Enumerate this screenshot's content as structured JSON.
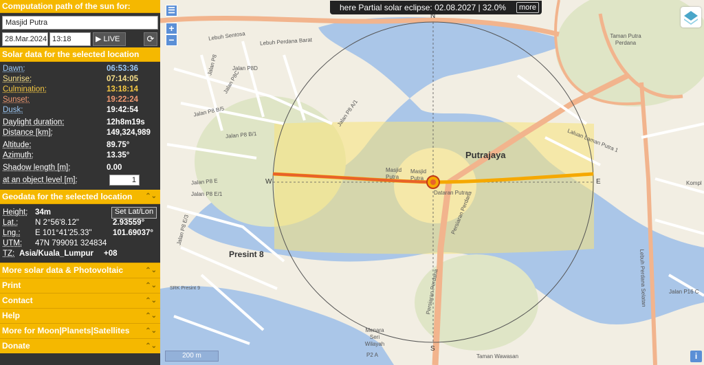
{
  "sidebar": {
    "title": "Computation path of the sun for:",
    "location": "Masjid Putra",
    "date": "28.Mar.2024",
    "time": "13:18 UTC+8",
    "live_label": "LIVE",
    "solar_header": "Solar data for the selected location",
    "solar": {
      "dawn_label": "Dawn:",
      "dawn": "06:53:36",
      "sunrise_label": "Sunrise:",
      "sunrise": "07:14:05",
      "culmination_label": "Culmination:",
      "culmination": "13:18:14",
      "sunset_label": "Sunset:",
      "sunset": "19:22:24",
      "dusk_label": "Dusk:",
      "dusk": "19:42:54",
      "daylight_label": "Daylight duration:",
      "daylight": "12h8m19s",
      "distance_label": "Distance [km]:",
      "distance": "149,324,989",
      "altitude_label": "Altitude:",
      "altitude": "89.75°",
      "azimuth_label": "Azimuth:",
      "azimuth": "13.35°",
      "shadow_label": "Shadow length [m]:",
      "shadow": "0.00",
      "object_label": "at an object level [m]:",
      "object": "1"
    },
    "geo_header": "Geodata for the selected location",
    "geo": {
      "height_label": "Height:",
      "height": "34m",
      "set_btn": "Set Lat/Lon",
      "lat_label": "Lat.:",
      "lat_dms": "N 2°56'8.12\"",
      "lat_dec": "2.93559°",
      "lng_label": "Lng.:",
      "lng_dms": "E 101°41'25.33\"",
      "lng_dec": "101.69037°",
      "utm_label": "UTM:",
      "utm": "47N 799091 324834",
      "tz_label": "TZ:",
      "tz": "Asia/Kuala_Lumpur",
      "tz_offset": "+08"
    },
    "menu": [
      "More solar data & Photovoltaic",
      "Print",
      "Contact",
      "Help",
      "More for Moon|Planets|Satellites",
      "Donate"
    ]
  },
  "map": {
    "eclipse_text": "here Partial solar eclipse: 02.08.2027 | 32.0%",
    "more_label": "more",
    "scale": "200 m",
    "compass": {
      "n": "N",
      "s": "S",
      "e": "E",
      "w": "W"
    },
    "labels": {
      "putrajaya": "Putrajaya",
      "presint8": "Presint 8",
      "masjid_putra": "Masjid Putra",
      "masjid_putra2": "Masjid Putra",
      "dataran_putra": "Dataran Putra",
      "taman_putra": "Taman Putra Perdana",
      "lebuh_sentosa": "Lebuh Sentosa",
      "lebuh_perdana_barat": "Lebuh Perdana Barat",
      "laluan_laman_putra": "Laluan Laman Putra 1",
      "persiaran_perdana": "Persiaran Perdana",
      "persiaran_perdana2": "Persiaran Perdana",
      "lebuh_perdana_selatan": "Lebuh Perdana Selatan",
      "taman_wawasan": "Taman Wawasan",
      "menara": "Menara Seri Wilayah",
      "srk": "SRK Presint 9",
      "jalan_p8": "Jalan P8",
      "jalan_p8d": "Jalan P8D",
      "jalan_p8c": "Jalan P8C",
      "jalan_p8b5": "Jalan P8 B/5",
      "jalan_p8b1": "Jalan P8 B/1",
      "jalan_p8e": "Jalan P8 E",
      "jalan_p8e1": "Jalan P8 E/1",
      "jalan_p8e3": "Jalan P8 E/3",
      "jalan_p8a1": "Jalan P8 A/1",
      "jalan_p16": "Jalan P16 C",
      "komplek": "Kompl",
      "p2a": "P2 A"
    },
    "colors": {
      "sun_path": "#f5a800",
      "sun_line": "#e8622a",
      "daylight_area": "#f7e37a",
      "water": "#aac6e8",
      "park": "#dfe5c6"
    }
  }
}
